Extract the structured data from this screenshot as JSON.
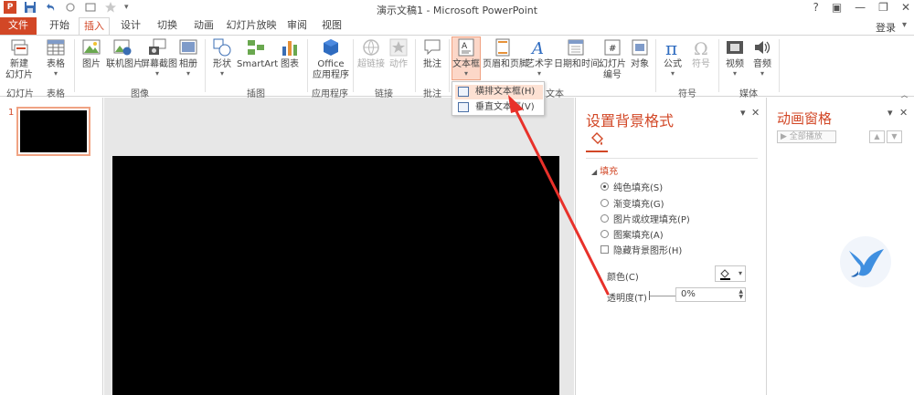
{
  "window": {
    "title": "演示文稿1 - Microsoft PowerPoint",
    "qat_logo": "P",
    "controls": [
      "?",
      "▣",
      "—",
      "❐",
      "✕"
    ]
  },
  "tabs": [
    {
      "label": "文件"
    },
    {
      "label": "开始"
    },
    {
      "label": "插入"
    },
    {
      "label": "设计"
    },
    {
      "label": "切换"
    },
    {
      "label": "动画"
    },
    {
      "label": "幻灯片放映"
    },
    {
      "label": "审阅"
    },
    {
      "label": "视图"
    }
  ],
  "login": "登录",
  "ribbon": {
    "buttons": {
      "new_slide": "新建",
      "new_slide2": "幻灯片",
      "table": "表格",
      "picture": "图片",
      "online_picture": "联机图片",
      "screenshot": "屏幕截图",
      "album": "相册",
      "shapes": "形状",
      "smartart": "SmartArt",
      "chart": "图表",
      "office_apps": "Office",
      "office_apps2": "应用程序",
      "hyperlink": "超链接",
      "action": "动作",
      "comment": "批注",
      "textbox": "文本框",
      "header_footer": "页眉和页脚",
      "wordart": "艺术字",
      "datetime": "日期和时间",
      "slide_number": "幻灯片",
      "slide_number2": "编号",
      "object": "对象",
      "equation": "公式",
      "symbol": "符号",
      "video": "视频",
      "audio": "音频"
    },
    "groups": {
      "slides": "幻灯片",
      "tables": "表格",
      "images": "图像",
      "illustrations": "插图",
      "apps": "应用程序",
      "links": "链接",
      "comments": "批注",
      "text": "文本",
      "symbols": "符号",
      "media": "媒体"
    }
  },
  "textbox_menu": {
    "items": [
      {
        "label": "横排文本框(H)"
      },
      {
        "label": "垂直文本框(V)"
      }
    ]
  },
  "thumbnails": {
    "slide_number": "1"
  },
  "format_background": {
    "title": "设置背景格式",
    "section": "填充",
    "options": [
      {
        "label": "纯色填充(S)",
        "selected": true
      },
      {
        "label": "渐变填充(G)",
        "selected": false
      },
      {
        "label": "图片或纹理填充(P)",
        "selected": false
      },
      {
        "label": "图案填充(A)",
        "selected": false
      }
    ],
    "hide_bg_graphics": "隐藏背景图形(H)",
    "color_label": "颜色(C)",
    "transparency_label": "透明度(T)",
    "transparency_value": "0%"
  },
  "animation_pane": {
    "title": "动画窗格",
    "play_all": "全部播放"
  },
  "colors": {
    "accent": "#d24726",
    "slide_bg": "#000000"
  }
}
